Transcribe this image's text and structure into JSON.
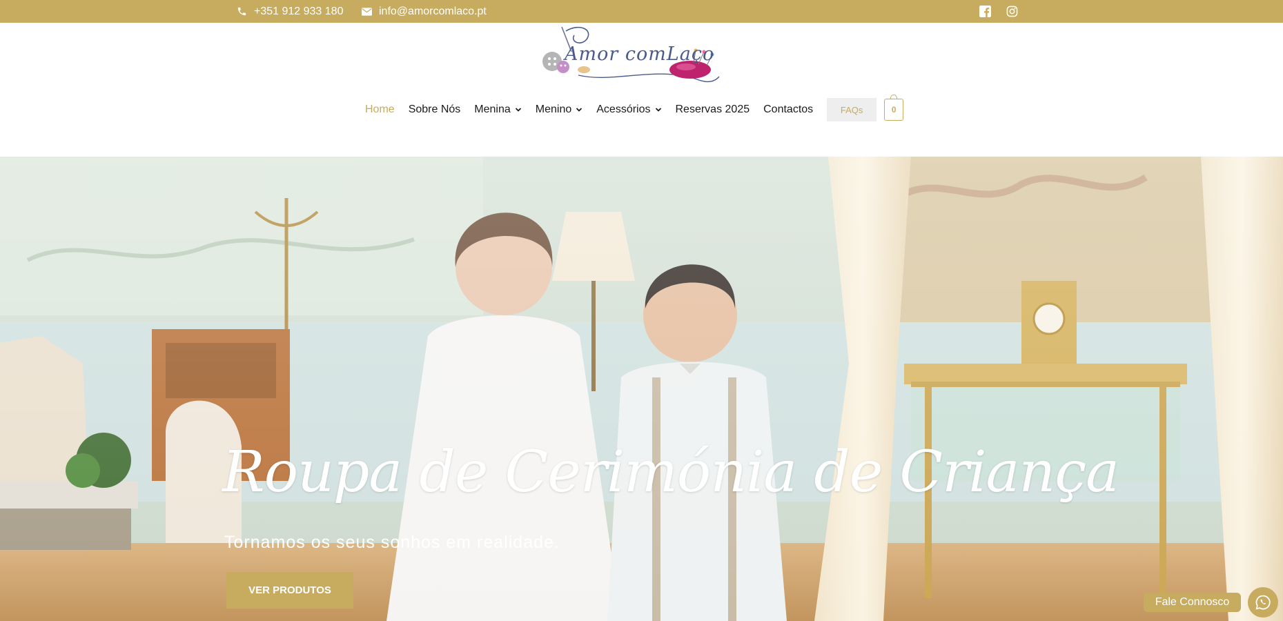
{
  "topbar": {
    "phone": "+351 912 933 180",
    "email": "info@amorcomlaco.pt",
    "icons": [
      "phone-icon",
      "envelope-icon",
      "facebook-icon",
      "instagram-icon"
    ]
  },
  "header": {
    "logo_text": "Amor comLaço",
    "nav": [
      {
        "label": "Home",
        "active": true
      },
      {
        "label": "Sobre Nós"
      },
      {
        "label": "Menina",
        "dropdown": true
      },
      {
        "label": "Menino",
        "dropdown": true
      },
      {
        "label": "Acessórios",
        "dropdown": true
      },
      {
        "label": "Reservas 2025"
      },
      {
        "label": "Contactos"
      }
    ],
    "faq_label": "FAQs",
    "cart_count": "0"
  },
  "hero": {
    "title": "Roupa de Cerimónia de Criança",
    "subtitle": "Tornamos os seus sonhos em realidade.",
    "button_label": "VER PRODUTOS"
  },
  "chat": {
    "label": "Fale Connosco"
  },
  "colors": {
    "brand_gold": "#c7ab5f",
    "text_dark": "#1a1a1a",
    "faq_bg": "#eeeeee"
  }
}
